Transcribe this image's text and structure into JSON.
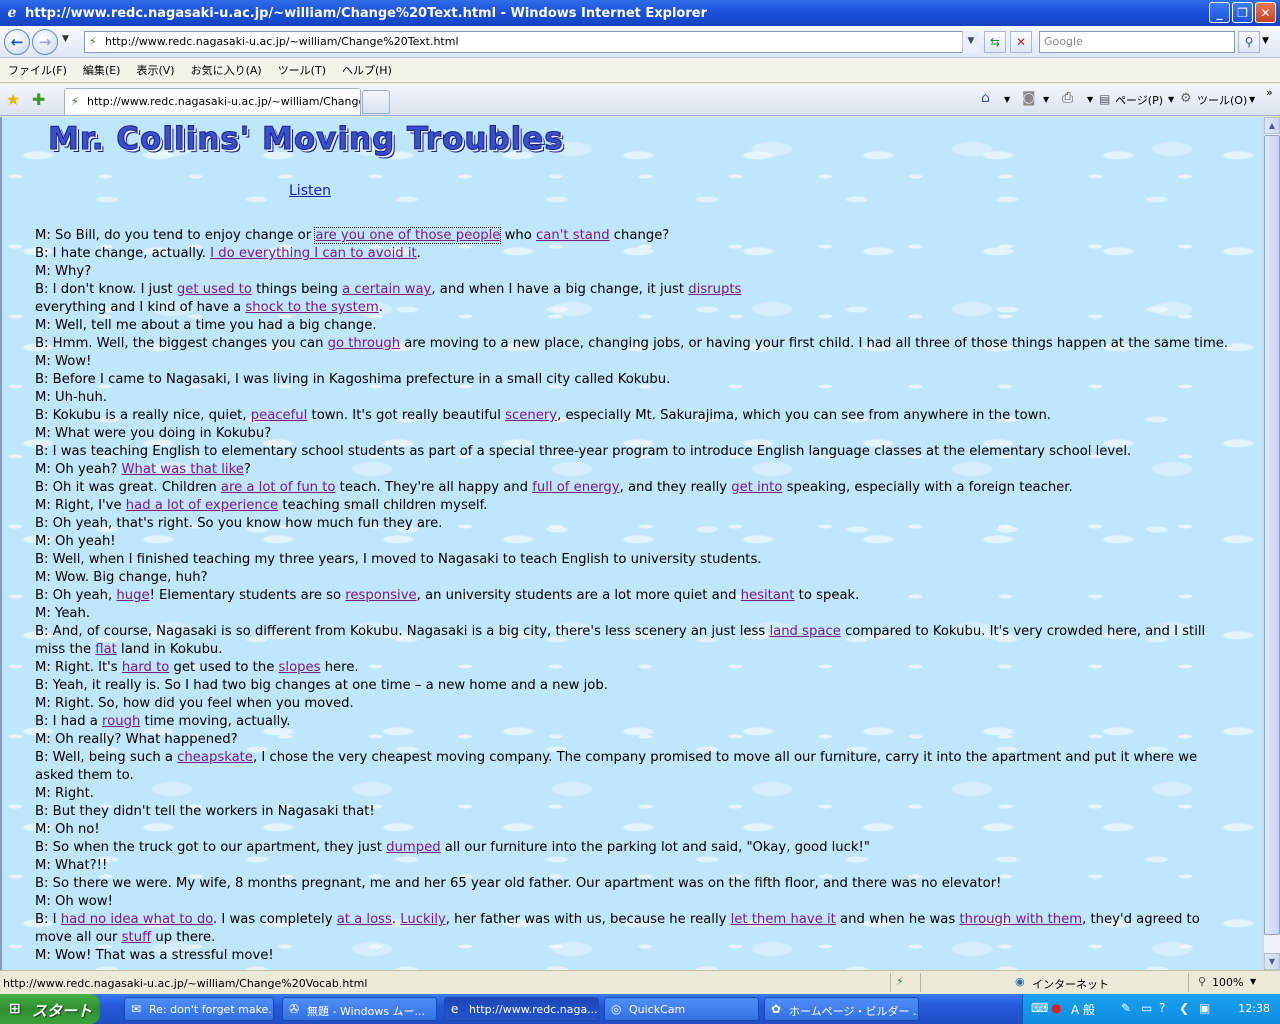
{
  "window": {
    "title": "http://www.redc.nagasaki-u.ac.jp/~william/Change%20Text.html - Windows Internet Explorer"
  },
  "address_bar": {
    "url": "http://www.redc.nagasaki-u.ac.jp/~william/Change%20Text.html",
    "search_placeholder": "Google"
  },
  "menu": [
    "ファイル(F)",
    "編集(E)",
    "表示(V)",
    "お気に入り(A)",
    "ツール(T)",
    "ヘルプ(H)"
  ],
  "tab": {
    "label": "http://www.redc.nagasaki-u.ac.jp/~william/Change%..."
  },
  "command_bar": {
    "page_label": "ページ(P)",
    "tools_label": "ツール(O)"
  },
  "page": {
    "title": "Mr. Collins' Moving Troubles",
    "listen": "Listen",
    "lines": [
      [
        {
          "t": "M: So Bill, do you tend to enjoy change or "
        },
        {
          "l": "are you one of those people",
          "focus": true
        },
        {
          "t": " who "
        },
        {
          "l": "can't stand"
        },
        {
          "t": " change?"
        }
      ],
      [
        {
          "t": "B: I hate change, actually. "
        },
        {
          "l": "I do everything I can to avoid it"
        },
        {
          "t": "."
        }
      ],
      [
        {
          "t": "M: Why?"
        }
      ],
      [
        {
          "t": "B: I don't know. I just "
        },
        {
          "l": "get used to"
        },
        {
          "t": " things being "
        },
        {
          "l": "a certain way"
        },
        {
          "t": ", and when I have a big change, it just "
        },
        {
          "l": "disrupts"
        }
      ],
      [
        {
          "t": "everything and I kind of have a "
        },
        {
          "l": "shock to the system"
        },
        {
          "t": "."
        }
      ],
      [
        {
          "t": "M: Well, tell me about a time you had a big change."
        }
      ],
      [
        {
          "t": "B: Hmm. Well, the biggest changes you can "
        },
        {
          "l": "go through"
        },
        {
          "t": " are moving to a new place, changing jobs, or having your first child. I had all three of those things happen at the same time."
        }
      ],
      [
        {
          "t": "M: Wow!"
        }
      ],
      [
        {
          "t": "B: Before I came to Nagasaki, I was living in Kagoshima prefecture in a small city called Kokubu."
        }
      ],
      [
        {
          "t": "M: Uh-huh."
        }
      ],
      [
        {
          "t": "B: Kokubu is a really nice, quiet, "
        },
        {
          "l": "peaceful"
        },
        {
          "t": " town. It's got really beautiful "
        },
        {
          "l": "scenery"
        },
        {
          "t": ", especially Mt. Sakurajima, which you can see from anywhere in the town."
        }
      ],
      [
        {
          "t": "M: What were you doing in Kokubu?"
        }
      ],
      [
        {
          "t": "B: I was teaching English to elementary school students as part of a special three-year program to introduce English language classes at the elementary school level."
        }
      ],
      [
        {
          "t": "M: Oh yeah? "
        },
        {
          "l": "What was that like"
        },
        {
          "t": "?"
        }
      ],
      [
        {
          "t": "B: Oh it was great. Children "
        },
        {
          "l": "are a lot of fun to"
        },
        {
          "t": " teach. They're all happy and "
        },
        {
          "l": "full of energy"
        },
        {
          "t": ", and they really "
        },
        {
          "l": "get into"
        },
        {
          "t": " speaking, especially with a foreign teacher."
        }
      ],
      [
        {
          "t": "M: Right, I've "
        },
        {
          "l": "had a lot of experience"
        },
        {
          "t": " teaching small children myself."
        }
      ],
      [
        {
          "t": "B: Oh yeah, that's right. So you know how much fun they are."
        }
      ],
      [
        {
          "t": "M: Oh yeah!"
        }
      ],
      [
        {
          "t": "B: Well, when I finished teaching my three years, I moved to Nagasaki to teach English to university students."
        }
      ],
      [
        {
          "t": "M: Wow. Big change, huh?"
        }
      ],
      [
        {
          "t": "B: Oh yeah, "
        },
        {
          "l": "huge"
        },
        {
          "t": "! Elementary students are so "
        },
        {
          "l": "responsive"
        },
        {
          "t": ", an university students are a lot more quiet and "
        },
        {
          "l": "hesitant"
        },
        {
          "t": " to speak."
        }
      ],
      [
        {
          "t": "M: Yeah."
        }
      ],
      [
        {
          "t": "B: And, of course, Nagasaki is so different from Kokubu. Nagasaki is a big city, there's less scenery an just less "
        },
        {
          "l": "land space"
        },
        {
          "t": " compared to Kokubu. It's very crowded here, and I still"
        }
      ],
      [
        {
          "t": "miss the "
        },
        {
          "l": "flat"
        },
        {
          "t": " land in Kokubu."
        }
      ],
      [
        {
          "t": "M: Right. It's "
        },
        {
          "l": "hard to"
        },
        {
          "t": " get used to the "
        },
        {
          "l": "slopes"
        },
        {
          "t": " here."
        }
      ],
      [
        {
          "t": "B: Yeah, it really is. So I had two big changes at one time – a new home and a new job."
        }
      ],
      [
        {
          "t": "M: Right. So, how did you feel when you moved."
        }
      ],
      [
        {
          "t": "B: I had a "
        },
        {
          "l": "rough"
        },
        {
          "t": " time moving, actually."
        }
      ],
      [
        {
          "t": "M: Oh really? What happened?"
        }
      ],
      [
        {
          "t": "B: Well, being such a "
        },
        {
          "l": "cheapskate"
        },
        {
          "t": ", I chose the very cheapest moving company. The company promised to move all our furniture, carry it into the apartment and put it where we"
        }
      ],
      [
        {
          "t": "asked them to."
        }
      ],
      [
        {
          "t": "M: Right."
        }
      ],
      [
        {
          "t": "B: But they didn't tell the workers in Nagasaki that!"
        }
      ],
      [
        {
          "t": "M: Oh no!"
        }
      ],
      [
        {
          "t": "B: So when the truck got to our apartment, they just "
        },
        {
          "l": "dumped"
        },
        {
          "t": " all our furniture into the parking lot and said, \"Okay, good luck!\""
        }
      ],
      [
        {
          "t": "M: What?!!"
        }
      ],
      [
        {
          "t": "B: So there we were. My wife, 8 months pregnant, me and her 65 year old father. Our apartment was on the fifth floor, and there was no elevator!"
        }
      ],
      [
        {
          "t": "M: Oh wow!"
        }
      ],
      [
        {
          "t": "B: I "
        },
        {
          "l": "had no idea what to do"
        },
        {
          "t": ". I was completely "
        },
        {
          "l": "at a loss"
        },
        {
          "t": ". "
        },
        {
          "l": "Luckily"
        },
        {
          "t": ", her father was with us, because he really "
        },
        {
          "l": "let them have it"
        },
        {
          "t": " and when he was "
        },
        {
          "l": "through with them"
        },
        {
          "t": ", they'd agreed to"
        }
      ],
      [
        {
          "t": "move all our "
        },
        {
          "l": "stuff"
        },
        {
          "t": " up there."
        }
      ],
      [
        {
          "t": "M: Wow! That was a stressful move!"
        }
      ]
    ]
  },
  "status_bar": {
    "url": "http://www.redc.nagasaki-u.ac.jp/~william/Change%20Vocab.html",
    "zone": "インターネット",
    "zoom": "100%"
  },
  "taskbar": {
    "start": "スタート",
    "tasks": [
      "Re: don't forget make...",
      "無題 - Windows ムー...",
      "http://www.redc.naga...",
      "QuickCam",
      "ホームページ・ビルダー ..."
    ],
    "tray_ime": "A 般",
    "clock": "12:38"
  }
}
